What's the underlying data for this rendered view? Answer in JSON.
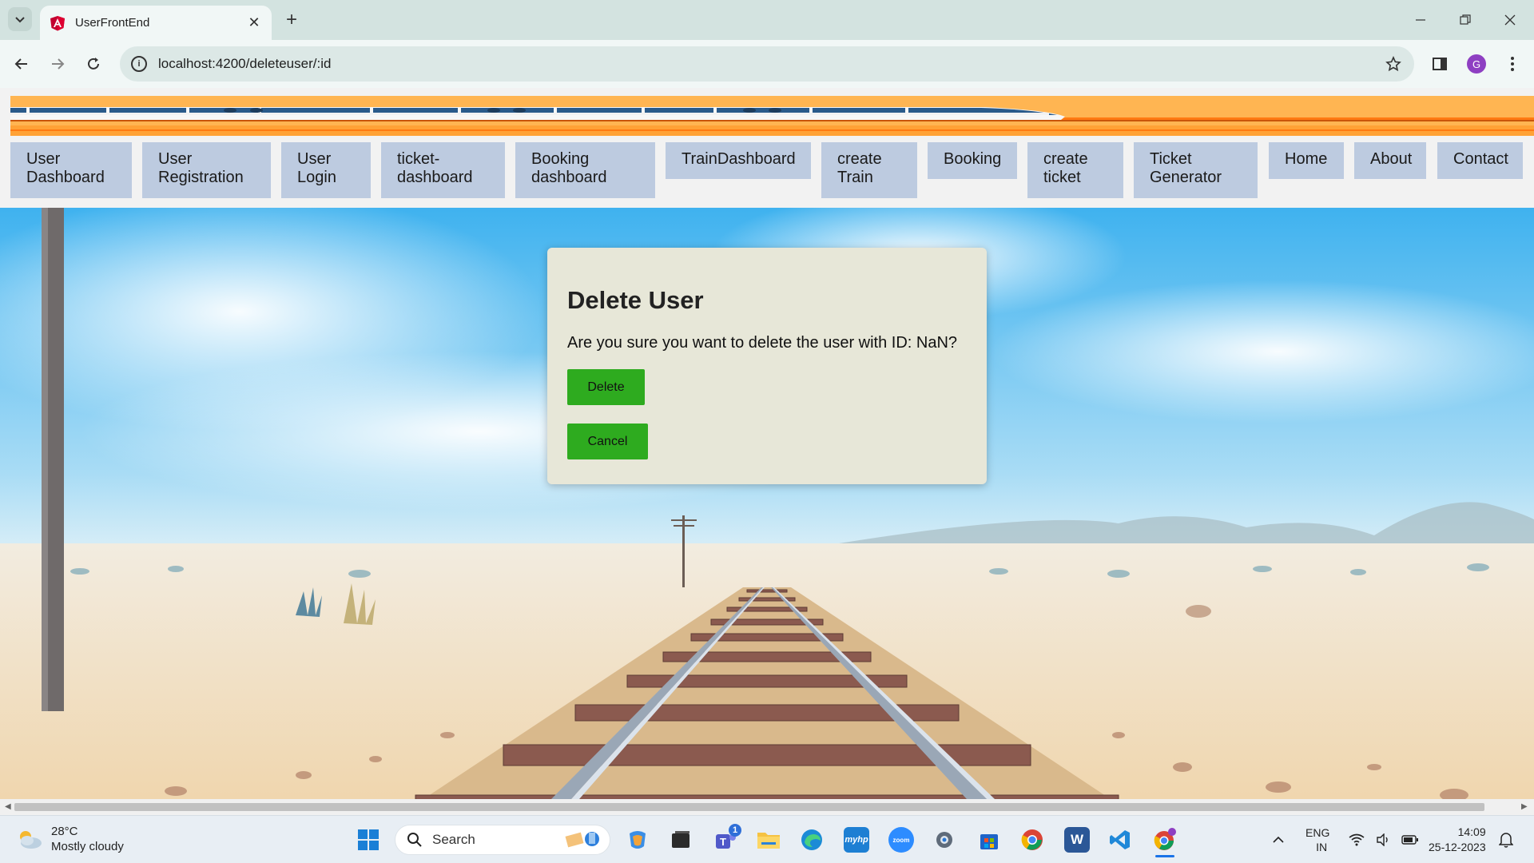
{
  "browser": {
    "tab_title": "UserFrontEnd",
    "url": "localhost:4200/deleteuser/:id",
    "profile_initial": "G"
  },
  "navbar": {
    "items": [
      {
        "label": "User Dashboard"
      },
      {
        "label": "User Registration"
      },
      {
        "label": "User Login"
      },
      {
        "label": "ticket-dashboard"
      },
      {
        "label": "Booking dashboard"
      },
      {
        "label": "TrainDashboard"
      },
      {
        "label": "create Train"
      },
      {
        "label": "Booking"
      },
      {
        "label": "create ticket"
      },
      {
        "label": "Ticket Generator"
      },
      {
        "label": "Home"
      },
      {
        "label": "About"
      },
      {
        "label": "Contact"
      }
    ]
  },
  "dialog": {
    "title": "Delete User",
    "message": "Are you sure you want to delete the user with ID: NaN?",
    "delete_label": "Delete",
    "cancel_label": "Cancel"
  },
  "taskbar": {
    "temperature": "28°C",
    "weather": "Mostly cloudy",
    "search_placeholder": "Search",
    "teams_badge": "1",
    "language": "ENG",
    "region": "IN",
    "time": "14:09",
    "date": "25-12-2023"
  },
  "colors": {
    "nav_item_bg": "#bdcbe0",
    "button_green": "#2eab1f",
    "dialog_bg": "#e7e7d8",
    "banner_orange": "#ffb04a"
  }
}
